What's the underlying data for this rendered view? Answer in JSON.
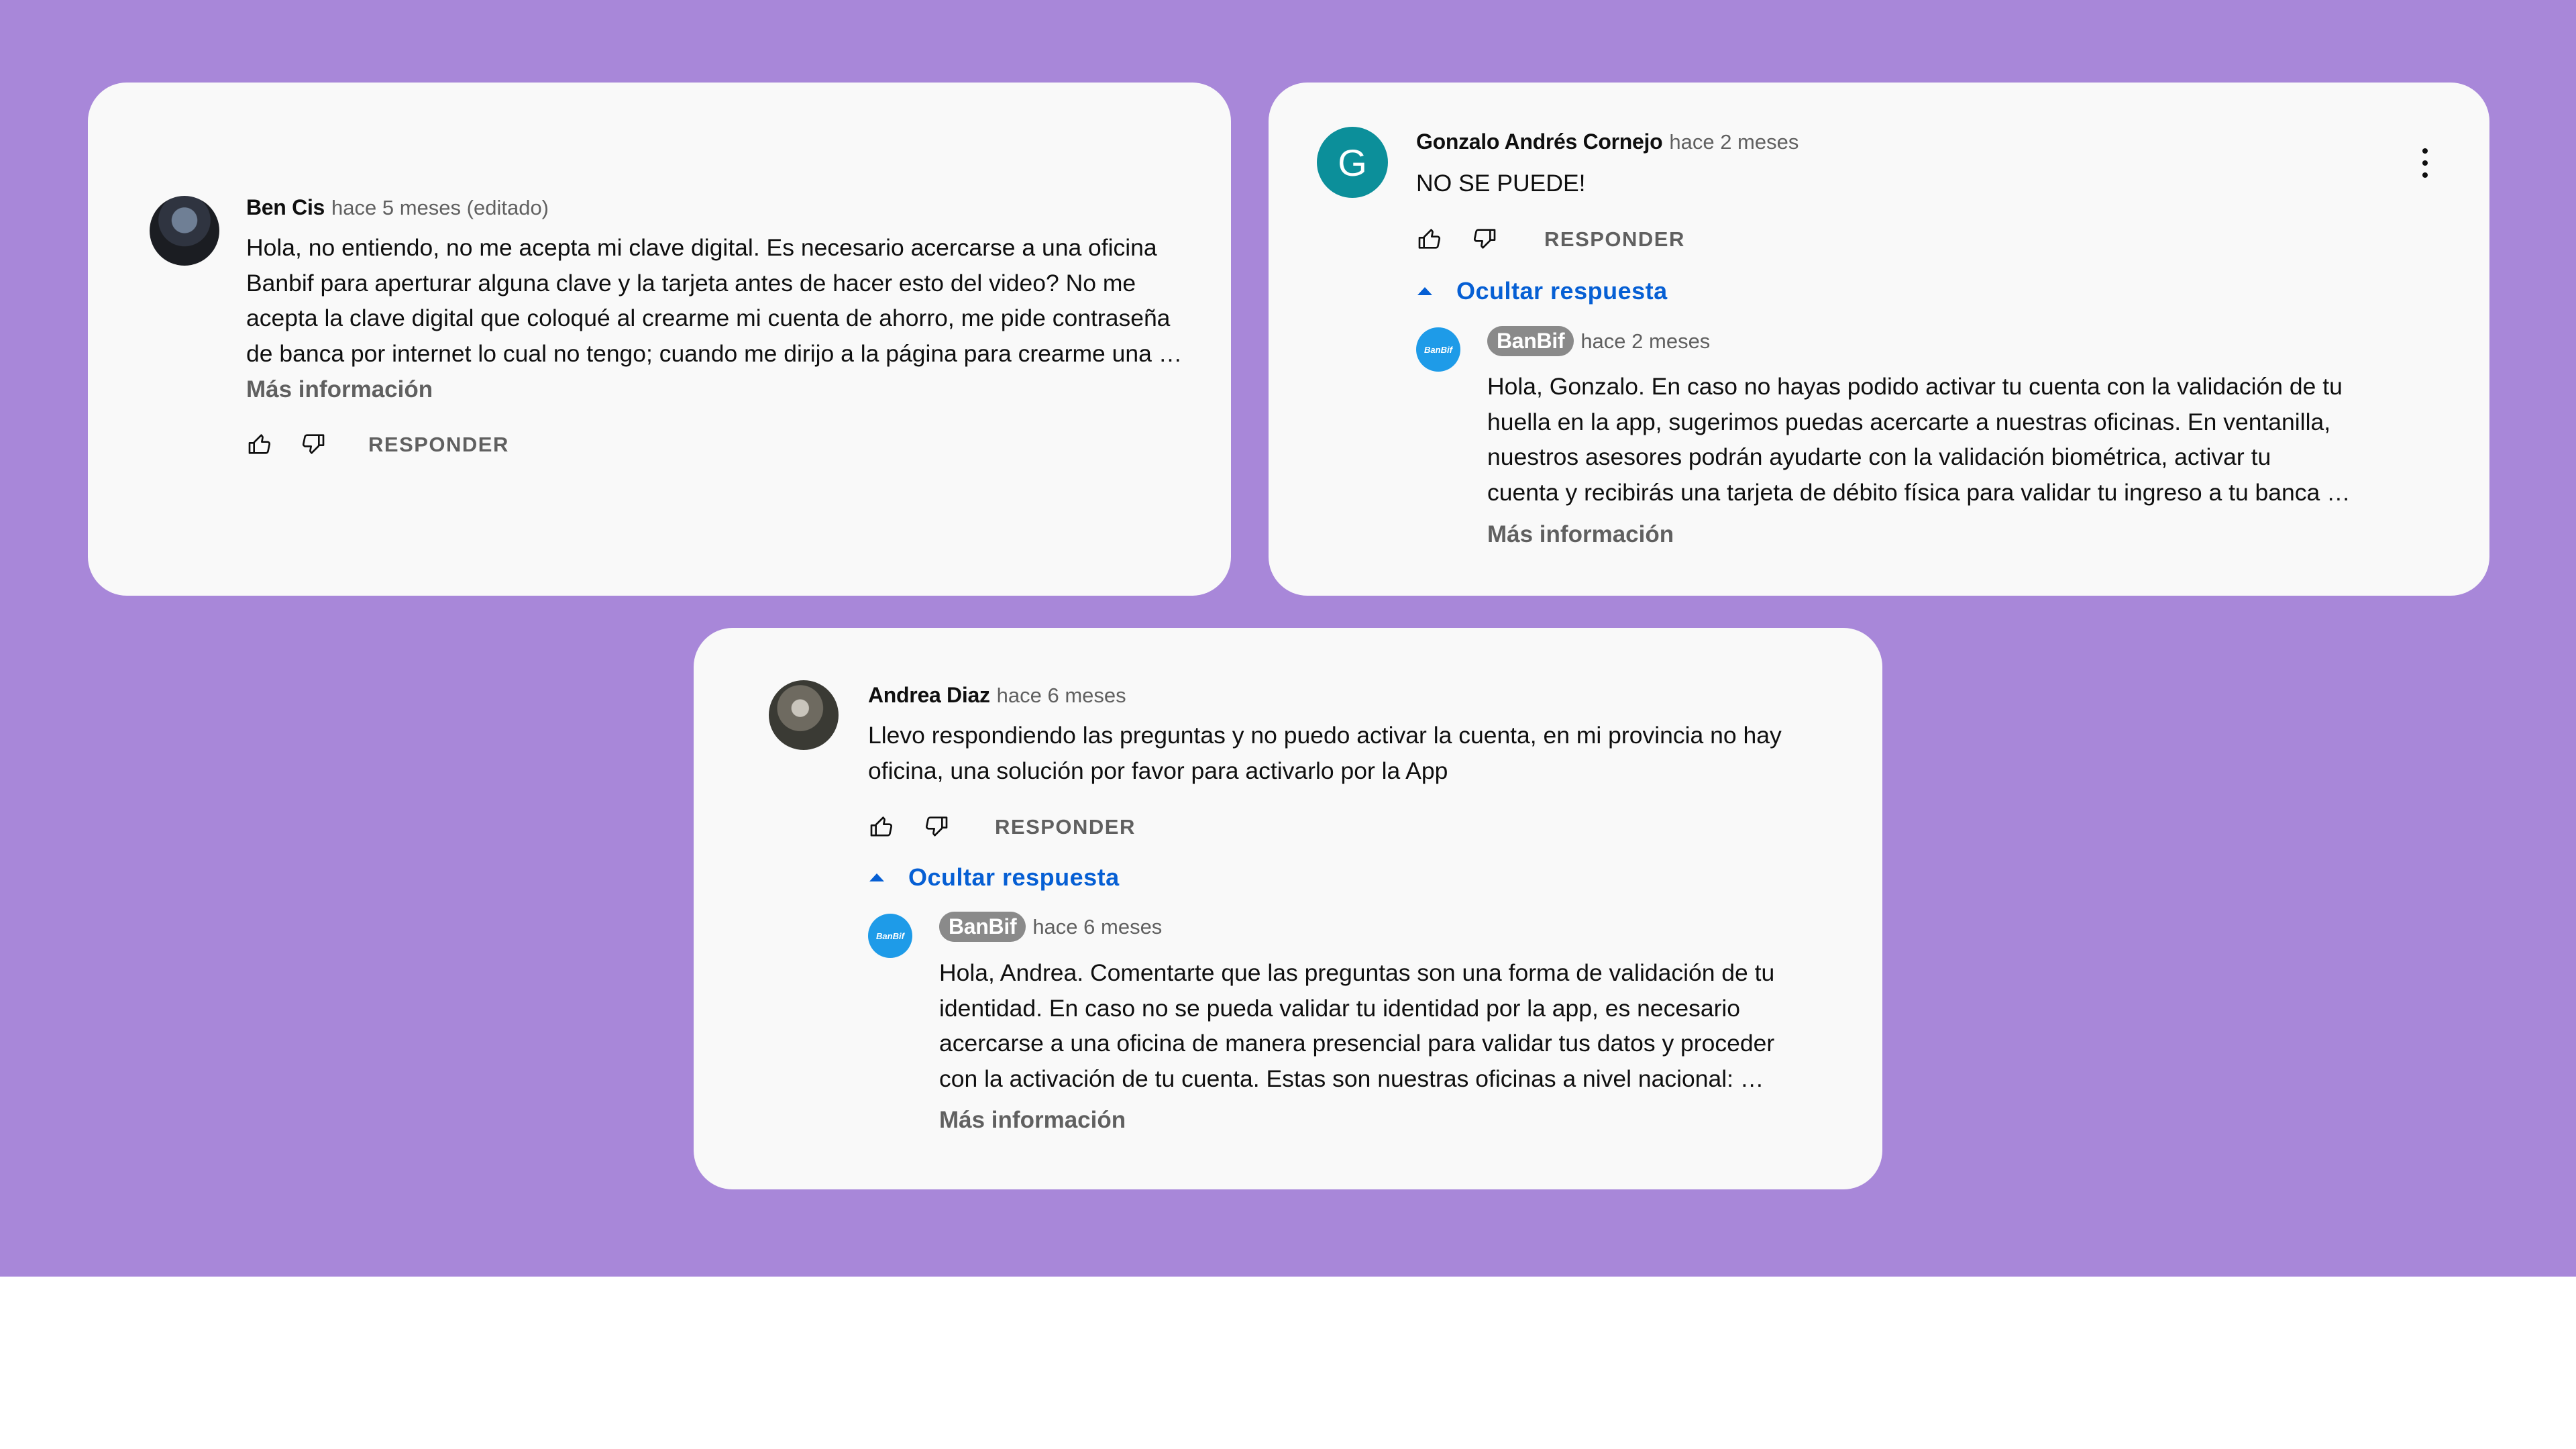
{
  "comments": [
    {
      "author": "Ben Cis",
      "time": "hace 5 meses (editado)",
      "lines": [
        "Hola, no entiendo, no me acepta mi clave digital. Es necesario acercarse a una oficina",
        "Banbif para aperturar alguna clave y la tarjeta antes de hacer esto del video? No me",
        "acepta la clave digital que coloqué al crearme mi cuenta de ahorro, me pide contraseña",
        "de banca por internet lo cual no tengo; cuando me dirijo a la página para crearme una …"
      ],
      "more": "Más información",
      "reply_label": "RESPONDER"
    },
    {
      "author": "Gonzalo Andrés Cornejo",
      "time": "hace 2 meses",
      "avatar_letter": "G",
      "lines": [
        "NO SE PUEDE!"
      ],
      "reply_label": "RESPONDER",
      "toggle_label": "Ocultar respuesta",
      "reply": {
        "author": "BanBif",
        "avatar_text": "BanBif",
        "time": "hace 2 meses",
        "lines": [
          "Hola, Gonzalo. En caso no hayas podido activar tu cuenta con la validación de tu",
          "huella en la app, sugerimos puedas acercarte a nuestras oficinas. En ventanilla,",
          "nuestros asesores podrán ayudarte con la validación biométrica, activar tu",
          "cuenta y recibirás una tarjeta de débito física para validar tu ingreso a tu banca …"
        ],
        "more": "Más información"
      }
    },
    {
      "author": "Andrea Diaz",
      "time": "hace 6 meses",
      "lines": [
        "Llevo respondiendo las preguntas y no puedo activar la cuenta, en mi provincia no hay",
        "oficina, una solución por favor para activarlo por la App"
      ],
      "reply_label": "RESPONDER",
      "toggle_label": "Ocultar respuesta",
      "reply": {
        "author": "BanBif",
        "avatar_text": "BanBif",
        "time": "hace 6 meses",
        "lines": [
          "Hola, Andrea. Comentarte que las preguntas son una forma de validación de tu",
          "identidad. En caso no se pueda validar tu identidad por la app, es necesario",
          "acercarse a una oficina de manera presencial para validar tus datos y proceder",
          "con la activación de tu cuenta. Estas son nuestras oficinas a nivel nacional: …"
        ],
        "more": "Más información"
      }
    }
  ],
  "colors": {
    "background": "#a887d9",
    "card": "#f9f9f9",
    "link": "#065fd4",
    "avatar_g": "#0c8f9a",
    "brand": "#1e9be8"
  },
  "icons": [
    "thumb-up-icon",
    "thumb-down-icon",
    "caret-up-icon",
    "more-vert-icon"
  ]
}
